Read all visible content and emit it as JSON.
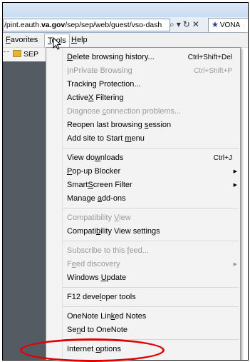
{
  "browser": {
    "url_plain": "/pint.eauth.",
    "url_domain": "va.gov",
    "url_path": "/sep/sep/web/guest/vso-dash",
    "search_icon": "⌕",
    "dropdown_icon": "▾",
    "refresh_icon": "↻",
    "stop_icon": "✕",
    "tab_label": "VONA",
    "tab_icon": "★"
  },
  "menubar": {
    "favorites": "Favorites",
    "tools": "Tools",
    "help": "Help"
  },
  "favorites_bar": {
    "item": "SEP"
  },
  "tools_menu": {
    "items": [
      {
        "pre": "",
        "u": "D",
        "post": "elete browsing history...",
        "shortcut": "Ctrl+Shift+Del"
      },
      {
        "pre": "",
        "u": "I",
        "post": "nPrivate Browsing",
        "shortcut": "Ctrl+Shift+P"
      },
      {
        "pre": "Tracking Protection...",
        "u": "",
        "post": "",
        "shortcut": ""
      },
      {
        "pre": "Active",
        "u": "X",
        "post": " Filtering",
        "shortcut": ""
      },
      {
        "pre": "Diagnose ",
        "u": "c",
        "post": "onnection problems...",
        "shortcut": ""
      },
      {
        "pre": "Reopen last browsing ",
        "u": "s",
        "post": "ession",
        "shortcut": ""
      },
      {
        "pre": "Add site to Start ",
        "u": "m",
        "post": "enu",
        "shortcut": ""
      },
      {
        "pre": "View do",
        "u": "w",
        "post": "nloads",
        "shortcut": "Ctrl+J"
      },
      {
        "pre": "",
        "u": "P",
        "post": "op-up Blocker",
        "shortcut": ""
      },
      {
        "pre": "Smart",
        "u": "S",
        "post": "creen Filter",
        "shortcut": ""
      },
      {
        "pre": "Manage ",
        "u": "a",
        "post": "dd-ons",
        "shortcut": ""
      },
      {
        "pre": "Compatibility ",
        "u": "V",
        "post": "iew",
        "shortcut": ""
      },
      {
        "pre": "Compati",
        "u": "b",
        "post": "ility View settings",
        "shortcut": ""
      },
      {
        "pre": "Subscribe to this ",
        "u": "f",
        "post": "eed...",
        "shortcut": ""
      },
      {
        "pre": "F",
        "u": "e",
        "post": "ed discovery",
        "shortcut": ""
      },
      {
        "pre": "Windows ",
        "u": "U",
        "post": "pdate",
        "shortcut": ""
      },
      {
        "pre": "F12 deve",
        "u": "l",
        "post": "oper tools",
        "shortcut": ""
      },
      {
        "pre": "OneNote Lin",
        "u": "k",
        "post": "ed Notes",
        "shortcut": ""
      },
      {
        "pre": "Se",
        "u": "n",
        "post": "d to OneNote",
        "shortcut": ""
      },
      {
        "pre": "Internet ",
        "u": "o",
        "post": "ptions",
        "shortcut": ""
      }
    ]
  },
  "submenu_arrow": "▶",
  "colors": {
    "highlight_oval": "#e10000",
    "disabled_text": "#9a9a9a",
    "content_bg": "#555b63"
  }
}
